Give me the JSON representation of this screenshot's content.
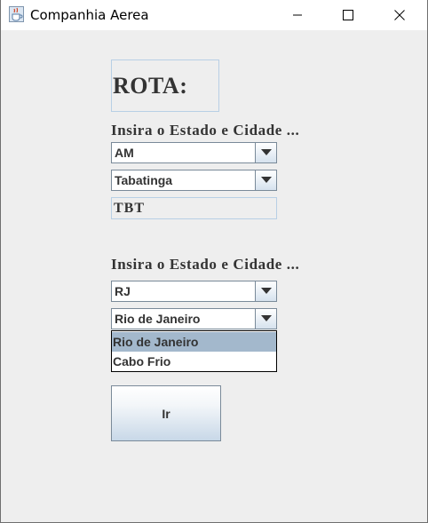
{
  "window": {
    "title": "Companhia Aerea",
    "icon": "java-cup-icon",
    "controls": [
      "minimize-icon",
      "maximize-icon",
      "close-icon"
    ]
  },
  "form": {
    "heading": "ROTA:",
    "origin": {
      "prompt": "Insira o Estado e Cidade ...",
      "state_value": "AM",
      "city_value": "Tabatinga",
      "airport_code": "TBT"
    },
    "destination": {
      "prompt": "Insira o Estado e Cidade ...",
      "state_value": "RJ",
      "city_value": "Rio de Janeiro",
      "city_options": [
        "Rio de Janeiro",
        "Cabo Frio"
      ],
      "highlighted_option": "Rio de Janeiro"
    },
    "submit_label": "Ir"
  },
  "colors": {
    "background": "#eeeeee",
    "selection": "#a3b8cc",
    "border": "#7a8a99"
  }
}
